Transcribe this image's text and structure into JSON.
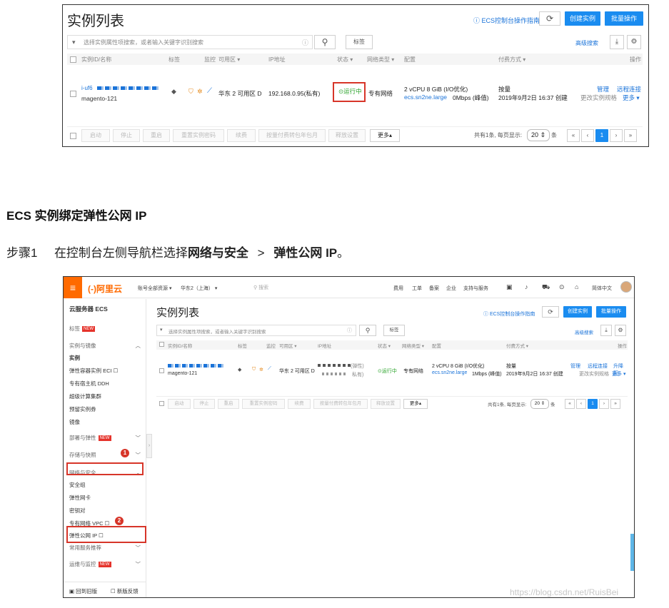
{
  "top_shot": {
    "title": "实例列表",
    "guide_link": "ECS控制台操作指南",
    "create_btn": "创建实例",
    "batch_btn": "批量操作",
    "search_placeholder": "选择实例属性项搜索，或者输入关键字识别搜索",
    "tag_btn": "标签",
    "advanced_search": "高级搜索",
    "columns": [
      "实例ID/名称",
      "标签",
      "监控",
      "可用区 ▾",
      "IP地址",
      "状态 ▾",
      "网络类型 ▾",
      "配置",
      "付费方式 ▾",
      "操作"
    ],
    "row": {
      "id": "i-uf6",
      "name": "magento-121",
      "zone": "华东 2 可用区 D",
      "ip": "192.168.0.95(私有)",
      "status": "运行中",
      "network": "专有网络",
      "config1": "2 vCPU 8 GiB (I/O优化)",
      "config2": "ecs.sn2ne.large",
      "bandwidth": "0Mbps (峰值)",
      "pay1": "按量",
      "pay2": "2019年9月2日 16:37 创建",
      "op_manage": "管理",
      "op_remote": "远程连接",
      "op_change": "更改实例规格",
      "op_more": "更多 ▾"
    },
    "footer_btns": [
      "启动",
      "停止",
      "重启",
      "重置实例密码",
      "续费",
      "按量付费转包年包月",
      "释放设置"
    ],
    "more_btn": "更多▴",
    "page_info": "共有1条, 每页显示:",
    "page_size": "20",
    "page_unit": "条",
    "pager": [
      "«",
      "‹",
      "1",
      "›",
      "»"
    ]
  },
  "heading": "ECS 实例绑定弹性公网 IP",
  "step": {
    "label": "步骤1",
    "text_a": "在控制台左侧导航栏选择",
    "bold_a": "网络与安全",
    "sep": ">",
    "bold_b": "弹性公网 IP",
    "end": "。"
  },
  "bottom_shot": {
    "logo": "(-)阿里云",
    "topnav": [
      "账号全部资源 ▾",
      "华东2（上海） ▾"
    ],
    "search_hint": "搜索",
    "right_nav": [
      "费用",
      "工单",
      "备案",
      "企业",
      "支持与服务"
    ],
    "lang": "简体中文",
    "sidebar_title": "云服务器 ECS",
    "sidebar_items": [
      {
        "label": "标签",
        "new": true
      },
      {
        "label": "实例与镜像"
      },
      {
        "label": "实例"
      },
      {
        "label": "弹性容器实例 ECI ☐"
      },
      {
        "label": "专有宿主机 DDH"
      },
      {
        "label": "超级计算集群"
      },
      {
        "label": "预留实例券"
      },
      {
        "label": "镜像"
      },
      {
        "label": "部署与弹性",
        "new": true
      },
      {
        "label": "存储与快照"
      },
      {
        "label": "网络与安全"
      },
      {
        "label": "安全组"
      },
      {
        "label": "弹性网卡"
      },
      {
        "label": "密钥对"
      },
      {
        "label": "专有网络 VPC ☐"
      },
      {
        "label": "弹性公网 IP ☐"
      },
      {
        "label": "常用服务推荐"
      },
      {
        "label": "运维与监控",
        "new": true
      }
    ],
    "sidebar_footer": [
      "回到旧版",
      "新版反馈"
    ],
    "badge1": "1",
    "badge2": "2",
    "title": "实例列表",
    "guide_link": "ECS控制台操作指南",
    "create_btn": "创建实例",
    "batch_btn": "批量操作",
    "search_placeholder": "选择实例属性项搜索，或者输入关键字识别搜索",
    "tag_btn": "标签",
    "advanced_search": "高级搜索",
    "columns": [
      "实例ID/名称",
      "标签",
      "监控",
      "可用区 ▾",
      "IP地址",
      "状态 ▾",
      "网络类型 ▾",
      "配置",
      "付费方式 ▾",
      "操作"
    ],
    "row": {
      "name": "magento-121",
      "zone": "华东 2 可用区 D",
      "ip1": "(弹性)",
      "ip2": "私有)",
      "status": "运行中",
      "network": "专有网络",
      "config1": "2 vCPU 8 GiB (I/O优化)",
      "config2": "ecs.sn2ne.large",
      "bandwidth": "1Mbps (峰值)",
      "pay1": "按量",
      "pay2": "2019年9月2日 16:37 创建",
      "op_manage": "管理",
      "op_remote": "远程连接",
      "op_upgrade": "升降配",
      "op_change": "更改实例规格",
      "op_more": "更多 ▾"
    },
    "footer_btns": [
      "启动",
      "停止",
      "重启",
      "重置实例密码",
      "续费",
      "按量付费转包年包月",
      "释放设置"
    ],
    "more_btn": "更多▴",
    "page_info": "共有1条, 每页显示:",
    "page_size": "20",
    "page_unit": "条",
    "pager": [
      "«",
      "‹",
      "1",
      "›",
      "»"
    ]
  },
  "watermark": "https://blog.csdn.net/RuisBei"
}
